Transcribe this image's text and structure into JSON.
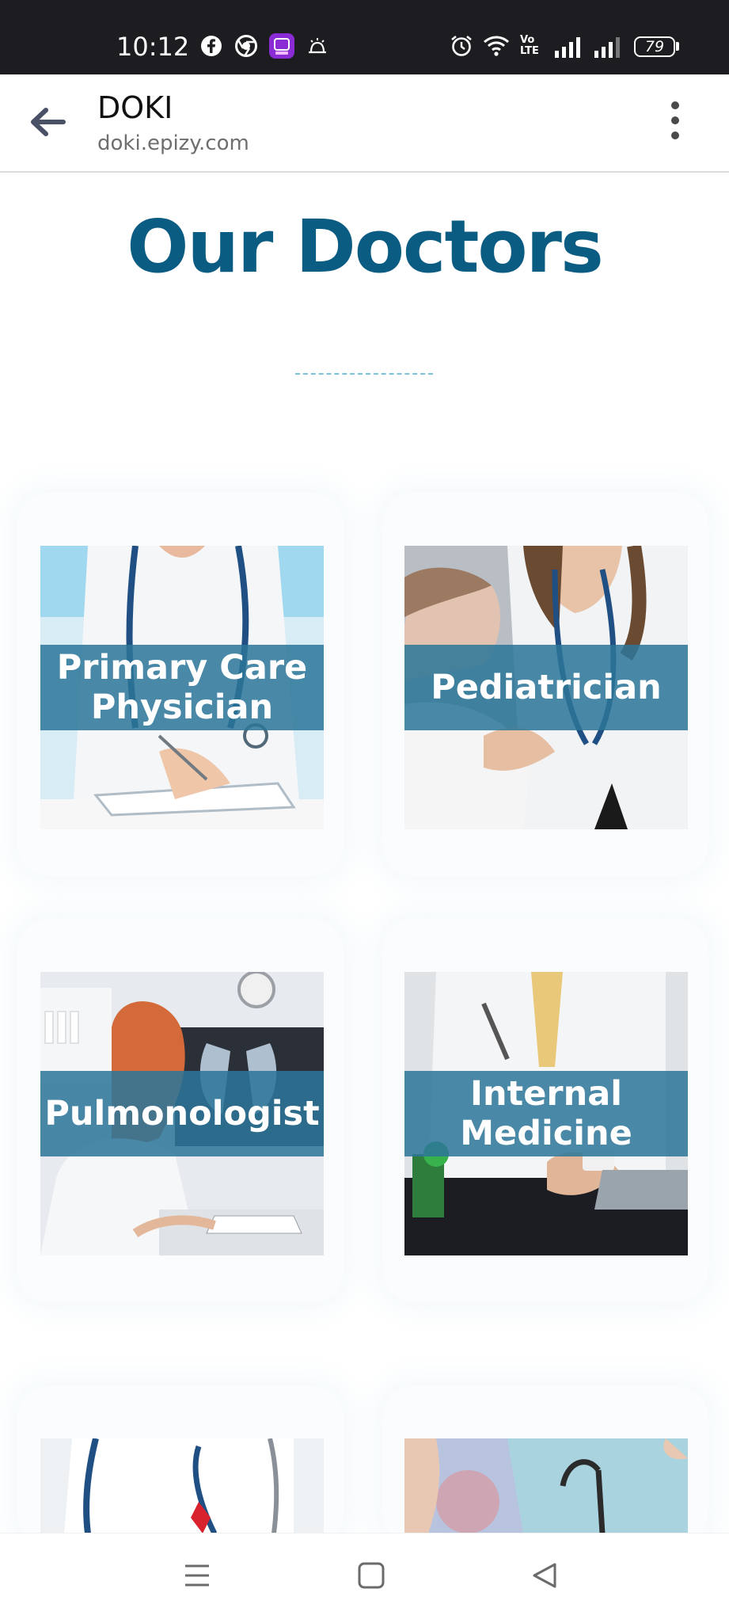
{
  "status_bar": {
    "time": "10:12",
    "network": "Vo LTE",
    "battery": "79",
    "icons": [
      "facebook-icon",
      "chrome-icon",
      "app-icon",
      "notification-icon",
      "alarm-icon",
      "wifi-icon",
      "signal-icon",
      "battery-icon"
    ]
  },
  "toolbar": {
    "title": "DOKI",
    "url": "doki.epizy.com",
    "icons": [
      "back-arrow-icon",
      "more-vert-icon"
    ]
  },
  "page": {
    "heading": "Our Doctors",
    "accent_color": "#0b5c82",
    "band_color": "#2c7698"
  },
  "doctors": [
    {
      "label": "Primary Care Physician"
    },
    {
      "label": "Pediatrician"
    },
    {
      "label": "Pulmonologist"
    },
    {
      "label": "Internal Medicine"
    }
  ],
  "nav_bar": {
    "icons": [
      "recents-icon",
      "home-icon",
      "back-icon"
    ]
  }
}
